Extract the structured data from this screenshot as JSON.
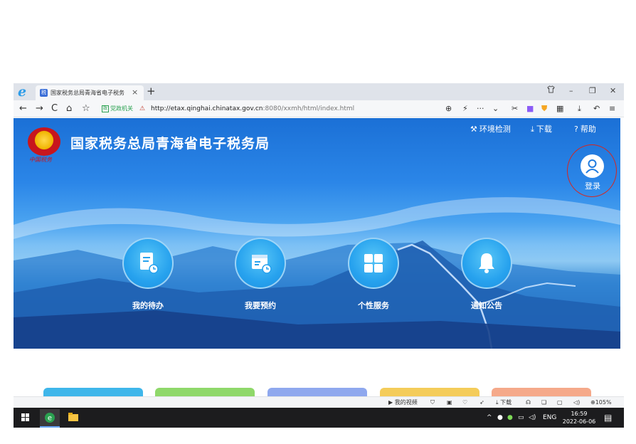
{
  "browser": {
    "tab_title": "国家税务总局青海省电子税务",
    "tab_favicon": "税",
    "new_tab": "+",
    "close_tab": "×",
    "gov_badge_box": "政",
    "gov_badge": "党政机关",
    "url_main": "http://etax.qinghai.chinatax.gov.cn",
    "url_path": ":8080/xxmh/html/index.html",
    "more": "···"
  },
  "page": {
    "emblem_caption": "中国税务",
    "site_title": "国家税务总局青海省电子税务局",
    "top_links": [
      {
        "label": "环境检测",
        "icon": "wrench-icon"
      },
      {
        "label": "下载",
        "icon": "download-icon"
      },
      {
        "label": "帮助",
        "icon": "help-circle-icon"
      }
    ],
    "login_label": "登录",
    "services": [
      {
        "label": "我的待办",
        "icon": "todo-list-icon"
      },
      {
        "label": "我要预约",
        "icon": "calendar-clock-icon"
      },
      {
        "label": "个性服务",
        "icon": "grid-icon"
      },
      {
        "label": "通知公告",
        "icon": "bell-icon"
      }
    ],
    "card_colors": [
      "#3fb6ea",
      "#8fd86a",
      "#8fa8ee",
      "#f4cc5a",
      "#f5a98a"
    ]
  },
  "status_bar": {
    "my_video": "我的视频",
    "download": "下载",
    "zoom": "105%"
  },
  "taskbar": {
    "lang": "ENG",
    "time": "16:59",
    "date": "2022-06-06"
  }
}
